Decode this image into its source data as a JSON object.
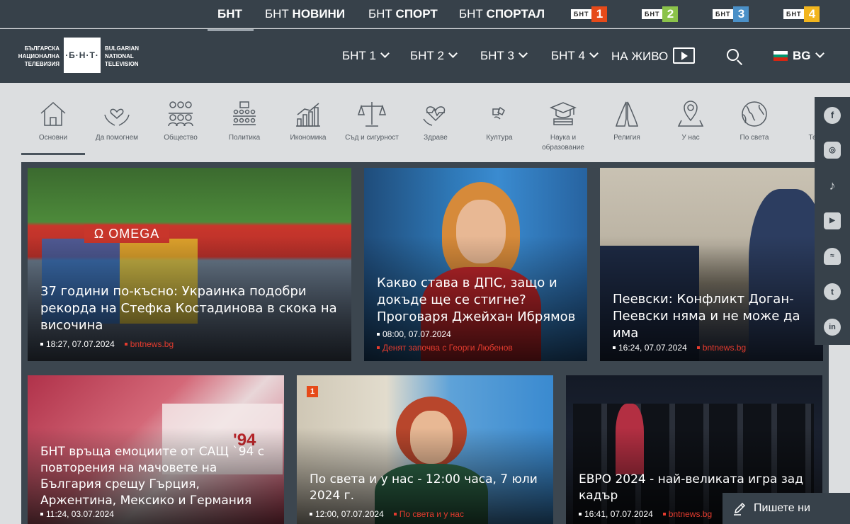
{
  "topbar": {
    "links": [
      "БНТ",
      "БНТ НОВИНИ",
      "БНТ СПОРТ",
      "БНТ СПОРТАЛ"
    ],
    "link_parts": [
      {
        "pre": "",
        "bold": "БНТ"
      },
      {
        "pre": "БНТ ",
        "bold": "НОВИНИ"
      },
      {
        "pre": "БНТ ",
        "bold": "СПОРТ"
      },
      {
        "pre": "БНТ ",
        "bold": "СПОРТАЛ"
      }
    ],
    "channels": [
      {
        "brand": "БНТ",
        "num": "1",
        "color": "#e64a19"
      },
      {
        "brand": "БНТ",
        "num": "2",
        "color": "#8bc34a"
      },
      {
        "brand": "БНТ",
        "num": "3",
        "color": "#4a90c8"
      },
      {
        "brand": "БНТ",
        "num": "4",
        "color": "#f2b51d"
      }
    ]
  },
  "header": {
    "logo_left": [
      "БЪЛГАРСКА",
      "НАЦИОНАЛНА",
      "ТЕЛЕВИЗИЯ"
    ],
    "logo_mark": "·Б·Н·Т·",
    "logo_right": [
      "BULGARIAN",
      "NATIONAL",
      "TELEVISION"
    ],
    "nav": [
      "БНТ 1",
      "БНТ 2",
      "БНТ 3",
      "БНТ 4"
    ],
    "live": "НА ЖИВО",
    "lang": "BG",
    "flag_colors": [
      "#ffffff",
      "#00966e",
      "#d62612"
    ]
  },
  "categories": [
    {
      "label": "Основни",
      "icon": "home-icon"
    },
    {
      "label": "Да помогнем",
      "icon": "helping-hands-icon"
    },
    {
      "label": "Общество",
      "icon": "people-icon"
    },
    {
      "label": "Политика",
      "icon": "parliament-icon"
    },
    {
      "label": "Икономика",
      "icon": "bar-chart-icon"
    },
    {
      "label": "Съд и сигурност",
      "icon": "scales-icon"
    },
    {
      "label": "Здраве",
      "icon": "health-icon"
    },
    {
      "label": "Култура",
      "icon": "culture-icon"
    },
    {
      "label": "Наука и образование",
      "icon": "graduation-cap-icon"
    },
    {
      "label": "Религия",
      "icon": "praying-hands-icon"
    },
    {
      "label": "У нас",
      "icon": "map-pin-icon"
    },
    {
      "label": "По света",
      "icon": "globe-icon"
    },
    {
      "label": "Техно",
      "icon": "tech-icon"
    }
  ],
  "articles": [
    {
      "title": "37 години по-късно: Украинка подобри рекорда на Стефка Костадинова в скока на височина",
      "time": "18:27, 07.07.2024",
      "source": "bntnews.bg"
    },
    {
      "title": "Какво става в ДПС, защо и докъде ще се стигне? Проговаря Джейхан Ибрямов",
      "time": "08:00, 07.07.2024",
      "source": "Денят започва с Георги Любенов"
    },
    {
      "title": "Пеевски: Конфликт Доган-Пеевски няма и не може да има",
      "time": "16:24, 07.07.2024",
      "source": "bntnews.bg"
    },
    {
      "title": "БНТ връща емоциите от САЩ `94 с повторения на мачовете на България срещу Гърция, Аржентина, Мексико и Германия",
      "time": "11:24, 03.07.2024",
      "source": ""
    },
    {
      "title": "По света и у нас - 12:00 часа, 7 юли 2024 г.",
      "time": "12:00, 07.07.2024",
      "source": "По света и у нас"
    },
    {
      "title": "ЕВРО 2024 - най-великата игра зад кадър",
      "time": "16:41, 07.07.2024",
      "source": "bntnews.bg"
    }
  ],
  "social": [
    "f",
    "ig",
    "tt",
    "yt",
    "sc",
    "tw",
    "in"
  ],
  "feedback": "Пишете ни"
}
